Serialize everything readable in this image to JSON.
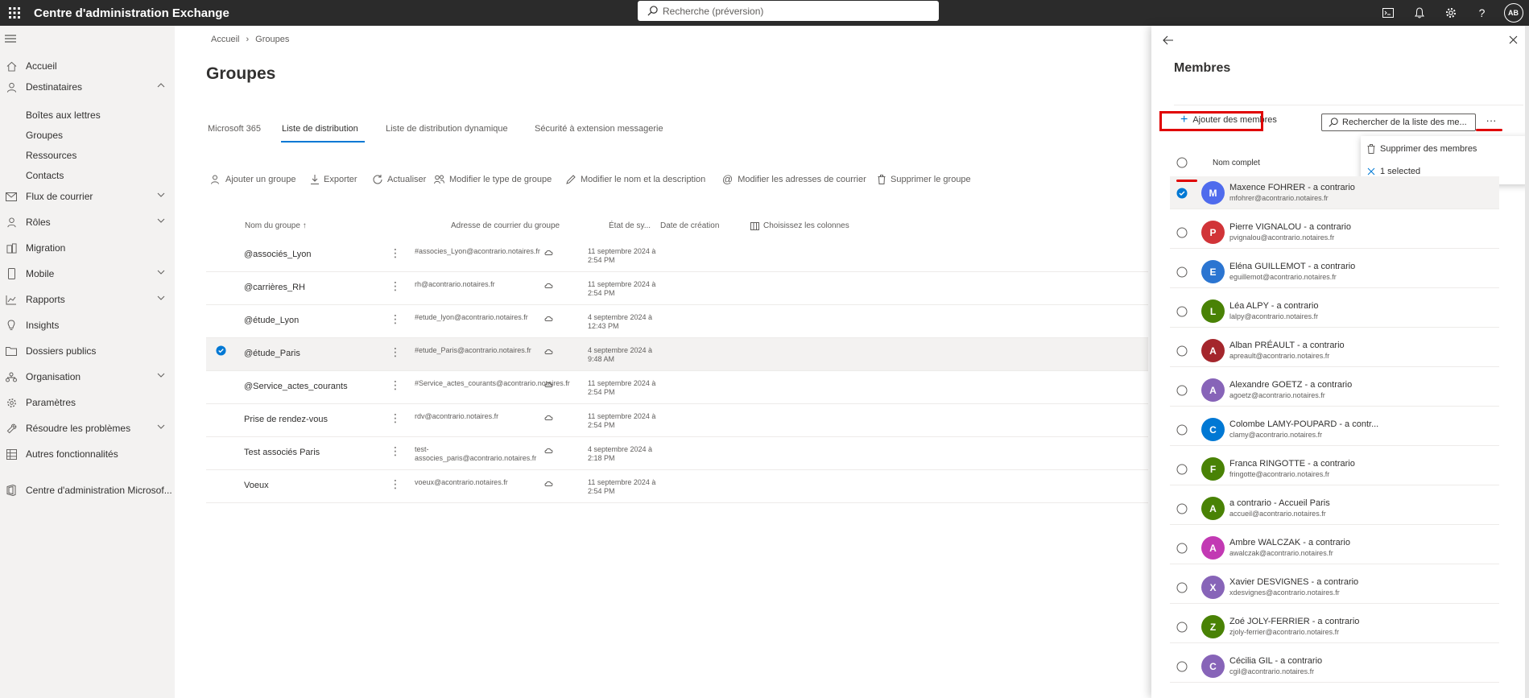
{
  "app": {
    "title": "Centre d'administration Exchange",
    "search_placeholder": "Recherche (préversion)",
    "user_initials": "AB"
  },
  "nav": {
    "items": [
      {
        "label": "Accueil",
        "icon": "home-icon"
      },
      {
        "label": "Destinataires",
        "icon": "person-icon"
      },
      {
        "label": "Flux de courrier",
        "icon": "mail-icon"
      },
      {
        "label": "Rôles",
        "icon": "roles-icon"
      },
      {
        "label": "Migration",
        "icon": "migration-icon"
      },
      {
        "label": "Mobile",
        "icon": "mobile-icon"
      },
      {
        "label": "Rapports",
        "icon": "chart-icon"
      },
      {
        "label": "Insights",
        "icon": "lightbulb-icon"
      },
      {
        "label": "Dossiers publics",
        "icon": "folder-icon"
      },
      {
        "label": "Organisation",
        "icon": "org-icon"
      },
      {
        "label": "Paramètres",
        "icon": "gear-icon"
      },
      {
        "label": "Résoudre les problèmes",
        "icon": "wrench-icon"
      },
      {
        "label": "Autres fonctionnalités",
        "icon": "grid-icon"
      },
      {
        "label": "Centre d'administration Microsof...",
        "icon": "office-icon"
      }
    ],
    "subitems": [
      "Boîtes aux lettres",
      "Groupes",
      "Ressources",
      "Contacts"
    ]
  },
  "breadcrumb": {
    "home": "Accueil",
    "current": "Groupes"
  },
  "page": {
    "title": "Groupes",
    "tabs": [
      "Microsoft 365",
      "Liste de distribution",
      "Liste de distribution dynamique",
      "Sécurité à extension messagerie"
    ],
    "commands": [
      "Ajouter un groupe",
      "Exporter",
      "Actualiser",
      "Modifier le type de groupe",
      "Modifier le nom et la description",
      "Modifier les adresses de courrier",
      "Supprimer le groupe"
    ],
    "columns": {
      "name": "Nom du groupe",
      "email": "Adresse de courrier du groupe",
      "sync": "État de sy...",
      "date": "Date de création",
      "choose": "Choisissez les colonnes"
    },
    "rows": [
      {
        "name": "@associés_Lyon",
        "email": "#associes_Lyon@acontrario.notaires.fr",
        "date": "11 septembre 2024 à 2:54 PM"
      },
      {
        "name": "@carrières_RH",
        "email": "rh@acontrario.notaires.fr",
        "date": "11 septembre 2024 à 2:54 PM"
      },
      {
        "name": "@étude_Lyon",
        "email": "#etude_lyon@acontrario.notaires.fr",
        "date": "4 septembre 2024 à 12:43 PM"
      },
      {
        "name": "@étude_Paris",
        "email": "#etude_Paris@acontrario.notaires.fr",
        "date": "4 septembre 2024 à 9:48 AM"
      },
      {
        "name": "@Service_actes_courants",
        "email": "#Service_actes_courants@acontrario.notaires.fr",
        "date": "11 septembre 2024 à 2:54 PM"
      },
      {
        "name": "Prise de rendez-vous",
        "email": "rdv@acontrario.notaires.fr",
        "date": "11 septembre 2024 à 2:54 PM"
      },
      {
        "name": "Test associés Paris",
        "email": "test-associes_paris@acontrario.notaires.fr",
        "date": "4 septembre 2024 à 2:18 PM"
      },
      {
        "name": "Voeux",
        "email": "voeux@acontrario.notaires.fr",
        "date": "11 septembre 2024 à 2:54 PM"
      }
    ]
  },
  "panel": {
    "title": "Membres",
    "add_label": "Ajouter des membres",
    "search_label": "Rechercher de la liste des me...",
    "more_label": "···",
    "menu": {
      "remove": "Supprimer des membres",
      "selected": "1 selected"
    },
    "column_header": "Nom complet",
    "members": [
      {
        "initial": "M",
        "name": "Maxence FOHRER - a contrario",
        "email": "mfohrer@acontrario.notaires.fr",
        "color": "#4f6bed"
      },
      {
        "initial": "P",
        "name": "Pierre VIGNALOU - a contrario",
        "email": "pvignalou@acontrario.notaires.fr",
        "color": "#d13438"
      },
      {
        "initial": "E",
        "name": "Eléna GUILLEMOT - a contrario",
        "email": "eguillemot@acontrario.notaires.fr",
        "color": "#2b75d1"
      },
      {
        "initial": "L",
        "name": "Léa ALPY - a contrario",
        "email": "lalpy@acontrario.notaires.fr",
        "color": "#498205"
      },
      {
        "initial": "A",
        "name": "Alban PRÉAULT - a contrario",
        "email": "apreault@acontrario.notaires.fr",
        "color": "#a4262c"
      },
      {
        "initial": "A",
        "name": "Alexandre GOETZ - a contrario",
        "email": "agoetz@acontrario.notaires.fr",
        "color": "#8764b8"
      },
      {
        "initial": "C",
        "name": "Colombe LAMY-POUPARD - a contr...",
        "email": "clamy@acontrario.notaires.fr",
        "color": "#0078d4"
      },
      {
        "initial": "F",
        "name": "Franca RINGOTTE - a contrario",
        "email": "fringotte@acontrario.notaires.fr",
        "color": "#498205"
      },
      {
        "initial": "A",
        "name": "a contrario - Accueil Paris",
        "email": "accueil@acontrario.notaires.fr",
        "color": "#498205"
      },
      {
        "initial": "A",
        "name": "Ambre WALCZAK - a contrario",
        "email": "awalczak@acontrario.notaires.fr",
        "color": "#c239b3"
      },
      {
        "initial": "X",
        "name": "Xavier DESVIGNES - a contrario",
        "email": "xdesvignes@acontrario.notaires.fr",
        "color": "#8764b8"
      },
      {
        "initial": "Z",
        "name": "Zoé JOLY-FERRIER - a contrario",
        "email": "zjoly-ferrier@acontrario.notaires.fr",
        "color": "#498205"
      },
      {
        "initial": "C",
        "name": "Cécilia GIL - a contrario",
        "email": "cgil@acontrario.notaires.fr",
        "color": "#8764b8"
      }
    ]
  },
  "colors": {
    "accent": "#0078d4",
    "annotation": "#e00000",
    "topbar": "#2b2b2b"
  }
}
